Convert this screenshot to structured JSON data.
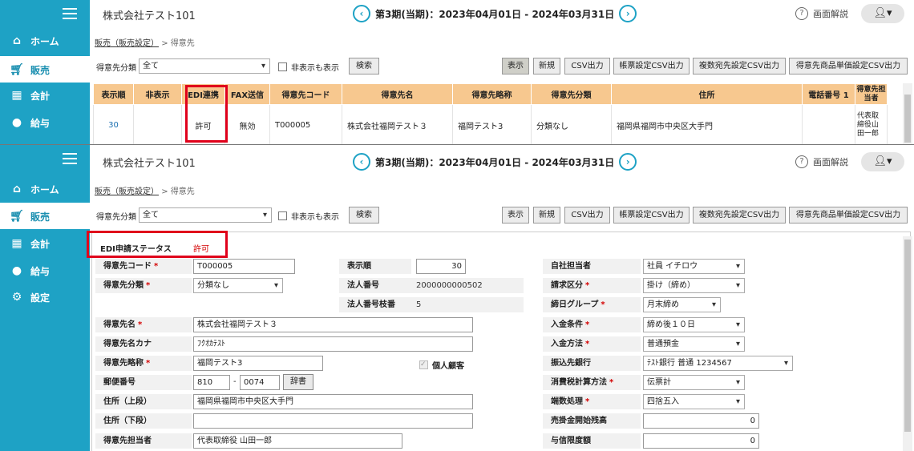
{
  "app": {
    "company": "株式会社テスト101",
    "period_text": "第3期(当期)：2023年04月01日 - 2024年03月31日",
    "help_label": "画面解説",
    "user_icon": "user-icon"
  },
  "nav": [
    {
      "label": "ホーム",
      "icon": "home-icon"
    },
    {
      "label": "販売",
      "icon": "cart-icon"
    },
    {
      "label": "会計",
      "icon": "calculator-icon"
    },
    {
      "label": "給与",
      "icon": "money-bag-icon"
    },
    {
      "label": "設定",
      "icon": "gear-icon"
    }
  ],
  "breadcrumb": {
    "link": "販売（販売設定）",
    "sep": ">",
    "current": "得意先"
  },
  "filter": {
    "label": "得意先分類",
    "select_value": "全て",
    "show_hidden": "非表示も表示",
    "search": "検索"
  },
  "toolbar": [
    "表示",
    "新規",
    "CSV出力",
    "帳票設定CSV出力",
    "複数宛先設定CSV出力",
    "得意先商品単価設定CSV出力"
  ],
  "table": {
    "headers": [
      "表示順",
      "非表示",
      "EDI連携",
      "FAX送信",
      "得意先コード",
      "得意先名",
      "得意先略称",
      "得意先分類",
      "住所",
      "電話番号 1",
      "得意先担当者"
    ],
    "row": [
      "30",
      "",
      "許可",
      "無効",
      "T000005",
      "株式会社福岡テスト３",
      "福岡テスト3",
      "分類なし",
      "福岡県福岡市中央区大手門",
      "",
      "代表取締役山田一郎"
    ]
  },
  "form": {
    "status_label": "EDI申請ステータス",
    "status_value": "許可",
    "left": [
      {
        "label": "得意先コード",
        "req": true,
        "value": "T000005"
      },
      {
        "label": "得意先分類",
        "req": true,
        "value": "分類なし"
      },
      {
        "label": "得意先名",
        "req": true,
        "value": "株式会社福岡テスト３"
      },
      {
        "label": "得意先名カナ",
        "req": false,
        "value": "ﾌｸｵｶﾃｽﾄ"
      },
      {
        "label": "得意先略称",
        "req": true,
        "value": "福岡テスト3"
      },
      {
        "label": "郵便番号",
        "req": false,
        "value": "810",
        "value2": "0074",
        "button": "辞書"
      },
      {
        "label": "住所（上段）",
        "req": false,
        "value": "福岡県福岡市中央区大手門"
      },
      {
        "label": "住所（下段）",
        "req": false,
        "value": ""
      },
      {
        "label": "得意先担当者",
        "req": false,
        "value": "代表取締役 山田一郎"
      }
    ],
    "middle": [
      {
        "label": "表示順",
        "value": "30"
      },
      {
        "label": "法人番号",
        "value": "2000000000502"
      },
      {
        "label": "法人番号枝番",
        "value": "5"
      },
      {
        "label": "個人顧客"
      }
    ],
    "right": [
      {
        "label": "自社担当者",
        "req": false,
        "value": "社員 イチロウ"
      },
      {
        "label": "請求区分",
        "req": true,
        "value": "掛け（締め）"
      },
      {
        "label": "締日グループ",
        "req": true,
        "value": "月末締め"
      },
      {
        "label": "入金条件",
        "req": true,
        "value": "締め後１０日"
      },
      {
        "label": "入金方法",
        "req": true,
        "value": "普通預金"
      },
      {
        "label": "振込先銀行",
        "req": false,
        "value": "ﾃｽﾄ銀行 普通 1234567"
      },
      {
        "label": "消費税計算方法",
        "req": true,
        "value": "伝票計"
      },
      {
        "label": "端数処理",
        "req": true,
        "value": "四捨五入"
      },
      {
        "label": "売掛金開始残高",
        "req": false,
        "value": "0"
      },
      {
        "label": "与信限度額",
        "req": false,
        "value": "0"
      }
    ]
  }
}
